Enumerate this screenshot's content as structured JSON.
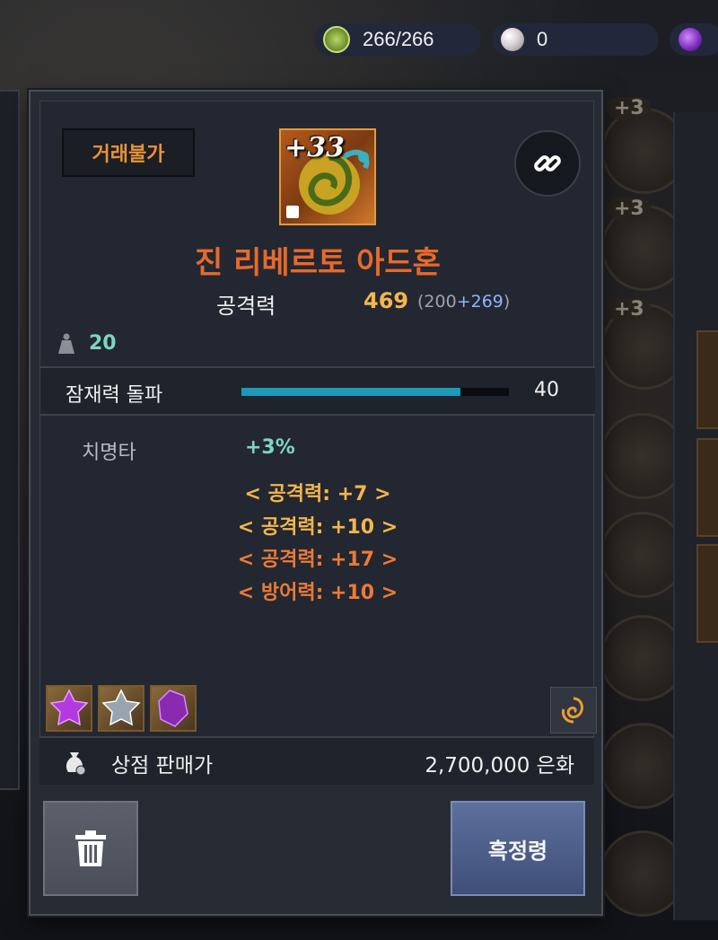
{
  "topbar": {
    "stamina_icon": "green-fist-icon",
    "stamina_value": "266/266",
    "pearl_icon": "pearl-icon",
    "pearl_value": "0",
    "crystal_icon": "purple-crystal-icon"
  },
  "background": {
    "slot_badge": "+3"
  },
  "tooltip": {
    "trade_badge": "거래불가",
    "enhance_level": "+33",
    "item_name": "진 리베르토 아드혼",
    "stat_label": "공격력",
    "stat_value": "469",
    "stat_base": "(200",
    "stat_bonus": "+269",
    "stat_close": ")",
    "weight_value": "20",
    "potential_label": "잠재력 돌파",
    "potential_value": "40",
    "potential_fill_percent": 82,
    "crit_label": "치명타",
    "crit_value": "+3%",
    "options": [
      {
        "text": "< 공격력: +7 >",
        "color": "gold"
      },
      {
        "text": "< 공격력: +10 >",
        "color": "gold"
      },
      {
        "text": "< 공격력: +17 >",
        "color": "orange"
      },
      {
        "text": "< 방어력: +10 >",
        "color": "orange"
      }
    ],
    "gems": [
      "purple-gem-icon",
      "silver-gem-icon",
      "purple-crystal-gem-icon"
    ],
    "sell_label": "상점 판매가",
    "sell_value": "2,700,000 은화",
    "dissolve_label": "흑정령"
  },
  "colors": {
    "item_name": "#e8692a",
    "stat_value": "#f2b64e",
    "bonus": "#8fb4ff",
    "potential_fill": "#1c9ab8",
    "teal": "#7fd4c0"
  }
}
